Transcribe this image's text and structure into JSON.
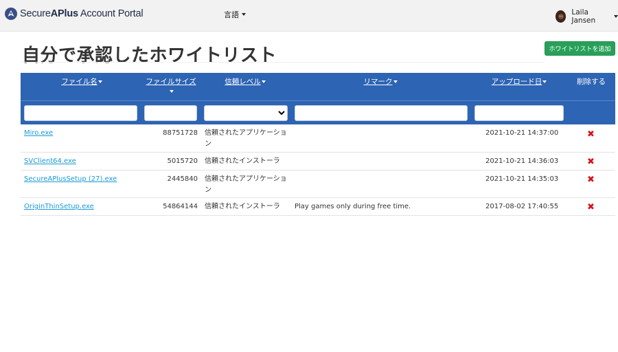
{
  "app": {
    "brand_prefix": "Secure",
    "brand_bold": "APlus",
    "brand_suffix": " Account Portal"
  },
  "nav": {
    "language_label": "言語",
    "user_name": "Laila Jansen"
  },
  "page": {
    "title": "自分で承認したホワイトリスト",
    "add_button": "ホワイトリストを追加"
  },
  "table": {
    "columns": [
      "ファイル名",
      "ファイルサイズ",
      "信頼レベル",
      "リマーク",
      "アップロード日",
      "削除する"
    ],
    "filters": {
      "filename": "",
      "filesize": "",
      "trust_level": "",
      "remark": "",
      "upload_date": ""
    },
    "rows": [
      {
        "filename": "Miro.exe",
        "filesize": "88751728",
        "trust": "信頼されたアプリケーション",
        "remark": "",
        "date": "2021-10-21 14:37:00"
      },
      {
        "filename": "SVClient64.exe",
        "filesize": "5015720",
        "trust": "信頼されたインストーラ",
        "remark": "",
        "date": "2021-10-21 14:36:03"
      },
      {
        "filename": "SecureAPlusSetup (27).exe",
        "filesize": "2445840",
        "trust": "信頼されたアプリケーション",
        "remark": "",
        "date": "2021-10-21 14:35:03"
      },
      {
        "filename": "OriginThinSetup.exe",
        "filesize": "54864144",
        "trust": "信頼されたインストーラ",
        "remark": "Play games only during free time.",
        "date": "2017-08-02 17:40:55"
      }
    ],
    "delete_glyph": "✖"
  },
  "colors": {
    "header_blue": "#2d64b3",
    "add_green": "#28a05a",
    "link": "#1a9ad6",
    "delete_red": "#d4151b"
  },
  "icons": {
    "brand": "shield-logo-icon",
    "caret": "caret-down-icon",
    "delete": "delete-x-icon"
  }
}
